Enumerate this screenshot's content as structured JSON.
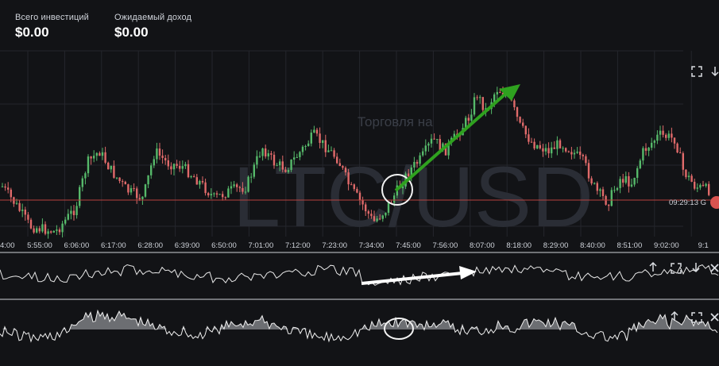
{
  "header": {
    "total_investments_label": "Всего инвестиций",
    "total_investments_value": "$0.00",
    "expected_income_label": "Ожидаемый доход",
    "expected_income_value": "$0.00"
  },
  "chart": {
    "watermark_title": "LTC/USD",
    "watermark_subtitle": "Торговля на",
    "price_line_time": "09:29:13 G",
    "colors": {
      "up": "#56b96a",
      "down": "#e06a6a",
      "price_line": "#b8423e",
      "trend_arrow": "#2fa11f",
      "background": "#121316"
    },
    "x_tick_labels": [
      "4:00",
      "5:55:00",
      "6:06:00",
      "6:17:00",
      "6:28:00",
      "6:39:00",
      "6:50:00",
      "7:01:00",
      "7:12:00",
      "7:23:00",
      "7:34:00",
      "7:45:00",
      "7:56:00",
      "8:07:00",
      "8:18:00",
      "8:29:00",
      "8:40:00",
      "8:51:00",
      "9:02:00",
      "9:1"
    ],
    "icons": {
      "main": [
        "fullscreen-icon",
        "arrow-down-icon"
      ],
      "indicator1": [
        "arrow-up-icon",
        "fullscreen-icon",
        "arrow-down-icon",
        "close-icon"
      ],
      "indicator2": [
        "arrow-up-icon",
        "fullscreen-icon",
        "close-icon"
      ]
    }
  }
}
